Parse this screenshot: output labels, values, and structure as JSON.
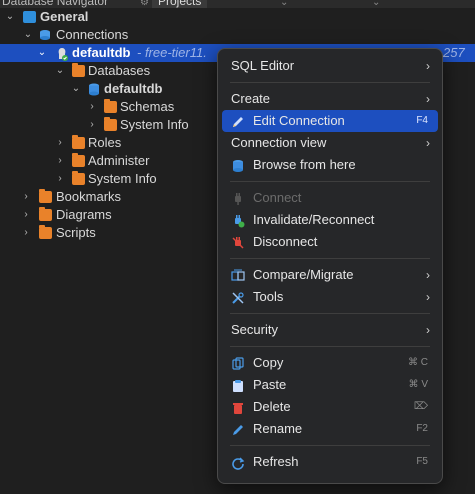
{
  "tabs": {
    "navigator": "Database Navigator",
    "projects": "Projects"
  },
  "tree": {
    "general": "General",
    "connections": "Connections",
    "conn_name": "defaultdb",
    "conn_desc": "- free-tier11.",
    "conn_suffix": "257",
    "databases": "Databases",
    "db_name": "defaultdb",
    "schemas": "Schemas",
    "system_info_db": "System Info",
    "roles": "Roles",
    "administer": "Administer",
    "system_info": "System Info",
    "bookmarks": "Bookmarks",
    "diagrams": "Diagrams",
    "scripts": "Scripts"
  },
  "menu": {
    "sql_editor": "SQL Editor",
    "create": "Create",
    "edit_connection": "Edit Connection",
    "edit_connection_sc": "F4",
    "connection_view": "Connection view",
    "browse_from_here": "Browse from here",
    "connect": "Connect",
    "invalidate_reconnect": "Invalidate/Reconnect",
    "disconnect": "Disconnect",
    "compare_migrate": "Compare/Migrate",
    "tools": "Tools",
    "security": "Security",
    "copy": "Copy",
    "copy_sc": "⌘ C",
    "paste": "Paste",
    "paste_sc": "⌘ V",
    "delete": "Delete",
    "rename": "Rename",
    "rename_sc": "F2",
    "refresh": "Refresh",
    "refresh_sc": "F5"
  },
  "colors": {
    "accent": "#1d4fbf",
    "folder": "#e9822a",
    "menu_bg": "#262729"
  }
}
